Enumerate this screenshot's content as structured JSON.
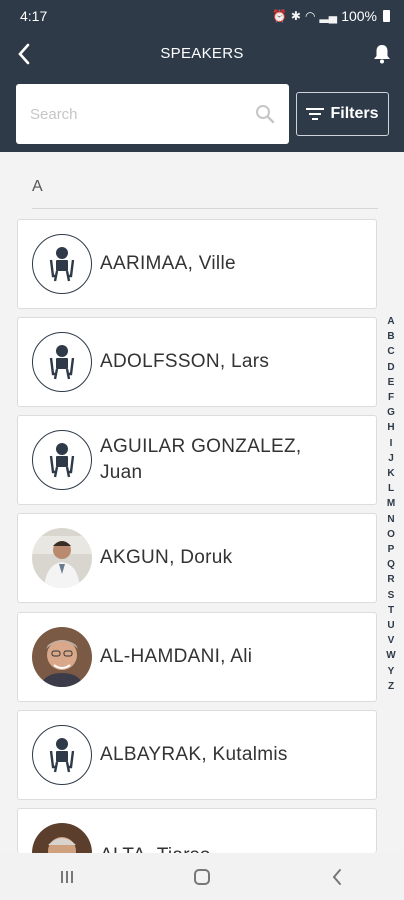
{
  "status": {
    "time": "4:17",
    "battery": "100%"
  },
  "header": {
    "title": "SPEAKERS"
  },
  "search": {
    "placeholder": "Search",
    "value": ""
  },
  "filters": {
    "label": "Filters"
  },
  "section": {
    "letter": "A"
  },
  "speakers": [
    {
      "name_line1": "AARIMAA, Ville",
      "name_line2": "",
      "avatar": "person-icon"
    },
    {
      "name_line1": "ADOLFSSON, Lars",
      "name_line2": "",
      "avatar": "person-icon"
    },
    {
      "name_line1": "AGUILAR GONZALEZ,",
      "name_line2": "Juan",
      "avatar": "person-icon"
    },
    {
      "name_line1": "AKGUN, Doruk",
      "name_line2": "",
      "avatar": "photo"
    },
    {
      "name_line1": "AL-HAMDANI, Ali",
      "name_line2": "",
      "avatar": "photo"
    },
    {
      "name_line1": "ALBAYRAK, Kutalmis",
      "name_line2": "",
      "avatar": "person-icon"
    },
    {
      "name_line1": "ALTA, Tiarso",
      "name_line2": "",
      "avatar": "photo"
    }
  ],
  "alphabet": [
    "A",
    "B",
    "C",
    "D",
    "E",
    "F",
    "G",
    "H",
    "I",
    "J",
    "K",
    "L",
    "M",
    "N",
    "O",
    "P",
    "Q",
    "R",
    "S",
    "T",
    "U",
    "V",
    "W",
    "Y",
    "Z"
  ],
  "colors": {
    "header_bg": "#2e3a48",
    "accent": "#2e3a48"
  }
}
